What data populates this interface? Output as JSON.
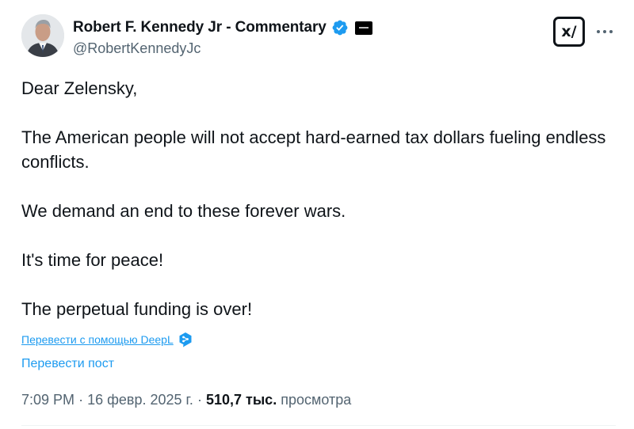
{
  "author": {
    "display_name": "Robert F. Kennedy Jr - Commentary",
    "handle": "@RobertKennedyJc",
    "verified_icon": "verified-badge-icon",
    "affiliate_icon": "affiliate-badge-icon"
  },
  "header_actions": {
    "grok_label": "x/",
    "grok_icon": "grok-icon",
    "more_icon": "more-options-icon"
  },
  "tweet": {
    "paragraphs": [
      "Dear Zelensky,",
      "The American people will not accept hard-earned tax dollars fueling endless conflicts.",
      "We demand an end to these forever wars.",
      "It's time for peace!",
      "The perpetual funding is over!"
    ]
  },
  "translation": {
    "deepl_label": "Перевести с помощью DeepL",
    "deepl_icon": "deepl-icon",
    "translate_post_label": "Перевести пост"
  },
  "meta": {
    "time": "7:09 PM",
    "date": "16 февр. 2025 г.",
    "views_count": "510,7 тыс.",
    "views_label": "просмотра",
    "separator": "·"
  },
  "colors": {
    "link": "#1d9bf0",
    "secondary_text": "#536471",
    "primary_text": "#0f1419",
    "verified": "#1d9bf0"
  }
}
